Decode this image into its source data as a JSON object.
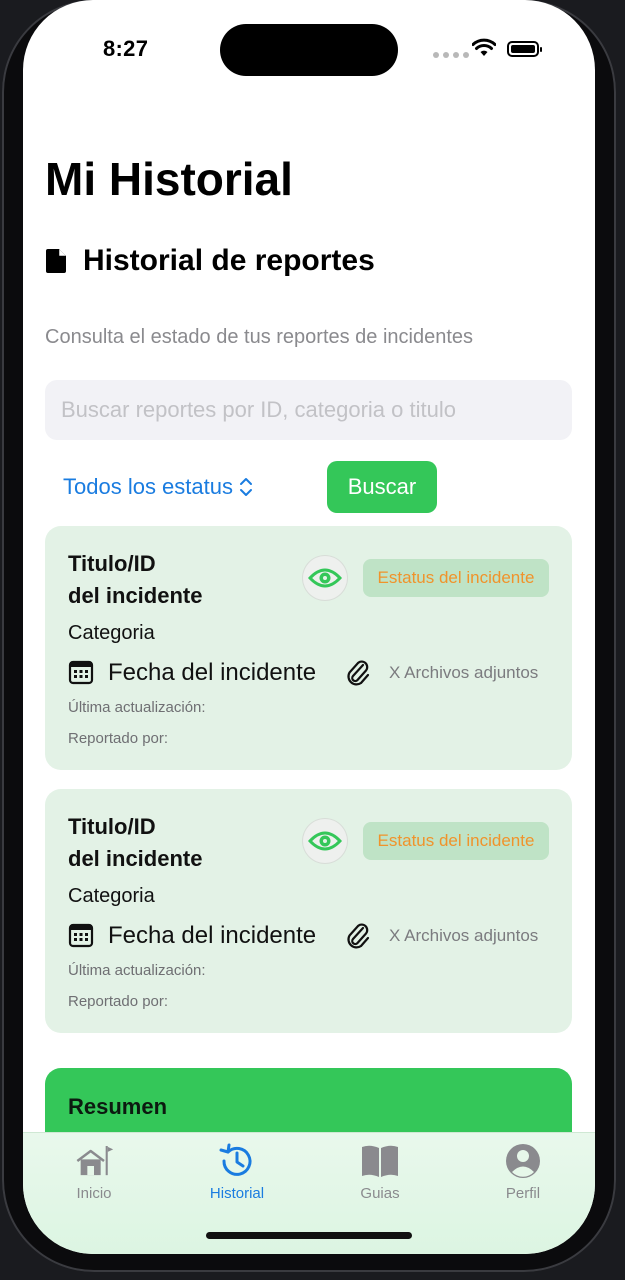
{
  "status_bar": {
    "time": "8:27"
  },
  "header": {
    "title": "Mi Historial"
  },
  "section": {
    "title": "Historial de reportes",
    "subtitle": "Consulta el estado de tus reportes de incidentes"
  },
  "search": {
    "value": "",
    "placeholder": "Buscar reportes por ID, categoria o titulo"
  },
  "filter": {
    "label": "Todos los estatus"
  },
  "search_button": {
    "label": "Buscar"
  },
  "reports": [
    {
      "title_line1": "Titulo/ID",
      "title_line2": "del incidente",
      "status": "Estatus del incidente",
      "category": "Categoria",
      "date": "Fecha del incidente",
      "attachments": "X Archivos adjuntos",
      "last_update": "Última actualización:",
      "reported_by": "Reportado por:"
    },
    {
      "title_line1": "Titulo/ID",
      "title_line2": "del incidente",
      "status": "Estatus del incidente",
      "category": "Categoria",
      "date": "Fecha del incidente",
      "attachments": "X Archivos adjuntos",
      "last_update": "Última actualización:",
      "reported_by": "Reportado por:"
    }
  ],
  "summary": {
    "title": "Resumen"
  },
  "tabbar": {
    "items": [
      {
        "label": "Inicio",
        "icon": "home-icon",
        "active": false
      },
      {
        "label": "Historial",
        "icon": "history-icon",
        "active": true
      },
      {
        "label": "Guias",
        "icon": "book-icon",
        "active": false
      },
      {
        "label": "Perfil",
        "icon": "profile-icon",
        "active": false
      }
    ]
  },
  "colors": {
    "accent_green": "#34c759",
    "accent_blue": "#1a7ce0",
    "status_orange": "#f0932b",
    "card_bg": "#e3f2e6"
  }
}
